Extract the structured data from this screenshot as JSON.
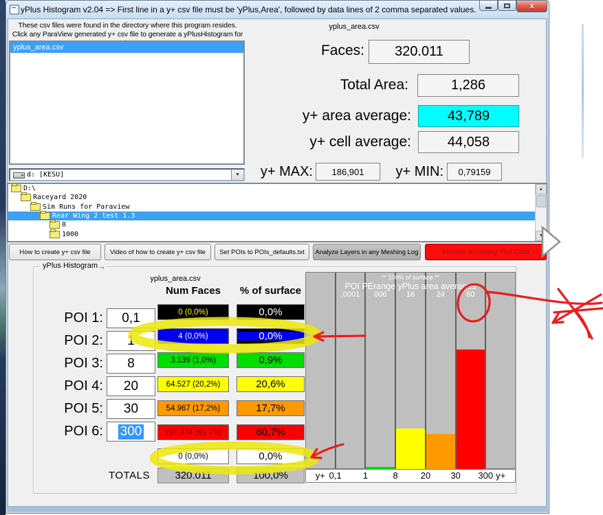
{
  "window": {
    "title": "yPlus Histogram v2.04 => First line in a y+ csv file must be 'yPlus,Area', followed by data lines of 2 comma separated values.",
    "controls": {
      "minimize": "minimize",
      "maximize": "maximize",
      "close": "close"
    }
  },
  "file_panel": {
    "instruction_line1": "These csv files were found in the directory where this program resides.",
    "instruction_line2": "Click any ParaView generated y+ csv file to generate a yPlusHistogram for it.",
    "files": [
      {
        "name": "yplus_area.csv",
        "selected": true
      }
    ]
  },
  "stats": {
    "csv_name": "yplus_area.csv",
    "faces_label": "Faces:",
    "faces_value": "320.011",
    "total_area_label": "Total Area:",
    "total_area_value": "1,286",
    "area_avg_label": "y+ area average:",
    "area_avg_value": "43,789",
    "area_avg_highlight": "#00ffff",
    "cell_avg_label": "y+ cell average:",
    "cell_avg_value": "44,058",
    "ymax_label": "y+ MAX:",
    "ymax_value": "186,901",
    "ymin_label": "y+ MIN:",
    "ymin_value": "0,79159"
  },
  "drive_combo": {
    "value": "d: [KESU]"
  },
  "dir_tree": {
    "items": [
      {
        "label": "D:\\",
        "indent": 0,
        "selected": false
      },
      {
        "label": "Raceyard 2020",
        "indent": 1,
        "selected": false
      },
      {
        "label": "Sim Runs for Paraview",
        "indent": 2,
        "selected": false
      },
      {
        "label": "Rear Wing 2 test 1.3",
        "indent": 3,
        "selected": true
      },
      {
        "label": "0",
        "indent": 4,
        "selected": false
      },
      {
        "label": "1000",
        "indent": 4,
        "selected": false
      }
    ]
  },
  "toolbar": {
    "buttons": [
      {
        "label": "How to create y+ csv file",
        "style": "normal"
      },
      {
        "label": "Video of how to create y+ csv file",
        "style": "normal"
      },
      {
        "label": "Set POIs to POIs_defaults.txt",
        "style": "normal"
      },
      {
        "label": "Analyze Layers in any Meshing Log",
        "style": "dark"
      },
      {
        "label": "Monitor Incoming Plot Data",
        "style": "red"
      }
    ]
  },
  "histogram": {
    "group_label": "yPlus Histogram .,",
    "csv_name": "yplus_area.csv",
    "col_header_faces": "Num Faces",
    "col_header_pct": "% of surface",
    "pois": [
      {
        "label": "POI 1:",
        "value": "0,1",
        "selected": false
      },
      {
        "label": "POI 2:",
        "value": "1",
        "selected": false
      },
      {
        "label": "POI 3:",
        "value": "8",
        "selected": false
      },
      {
        "label": "POI 4:",
        "value": "20",
        "selected": false
      },
      {
        "label": "POI 5:",
        "value": "30",
        "selected": false
      },
      {
        "label": "POI 6:",
        "value": "300",
        "selected": true
      }
    ],
    "rows": [
      {
        "num": "0 (0,0%)",
        "pct": "0,0%",
        "bg": "#000000",
        "num_color": "#ffff00",
        "pct_color": "#ffffff",
        "pct_variant": ""
      },
      {
        "num": "4 (0,0%)",
        "pct": "0,0%",
        "bg": "#0000f0",
        "num_color": "#ffffff",
        "pct_color": "#ffffff",
        "pct_variant": "black-edges"
      },
      {
        "num": "3.139 (1,0%)",
        "pct": "0,9%",
        "bg": "#00dd00",
        "num_color": "#000000",
        "pct_color": "#000000",
        "pct_variant": ""
      },
      {
        "num": "64.527 (20,2%)",
        "pct": "20,6%",
        "bg": "#ffff00",
        "num_color": "#000000",
        "pct_color": "#000000",
        "pct_variant": ""
      },
      {
        "num": "54.967 (17,2%)",
        "pct": "17,7%",
        "bg": "#ff9900",
        "num_color": "#000000",
        "pct_color": "#000000",
        "pct_variant": ""
      },
      {
        "num": "197.374 (61,7%)",
        "pct": "60,7%",
        "bg": "#ff0000",
        "num_color": "#7a0000",
        "pct_color": "#000000",
        "pct_variant": ""
      },
      {
        "num": "0 (0,0%)",
        "pct": "0,0%",
        "bg": "#ffffff",
        "num_color": "#000000",
        "pct_color": "#000000",
        "pct_variant": ""
      }
    ],
    "totals_label": "TOTALS",
    "totals": {
      "num": "320.011",
      "pct": "100,0%"
    }
  },
  "chart_data": {
    "type": "bar",
    "title": "** 100% of surface **",
    "subtitle": "POI PErange yPlus area averages",
    "categories": [
      "y+ < 0,1",
      "0,1 - 1",
      "1 - 8",
      "8 - 20",
      "20 - 30",
      "30 - 300",
      "300 < y+"
    ],
    "values": [
      0.0,
      0.0,
      0.9,
      20.6,
      17.7,
      60.7,
      0.0
    ],
    "bar_colors": [
      "#000000",
      "#0000f0",
      "#00dd00",
      "#ffff00",
      "#ff9900",
      "#ff0000",
      "#ffffff"
    ],
    "range_averages": [
      {
        "col": 1,
        "text": ",0001"
      },
      {
        "col": 2,
        "text": "006"
      },
      {
        "col": 3,
        "text": "16"
      },
      {
        "col": 4,
        "text": "24"
      },
      {
        "col": 5,
        "text": "60"
      }
    ],
    "x_axis_labels": [
      "y+",
      "0,1",
      "1",
      "8",
      "20",
      "30",
      "300",
      "y+"
    ],
    "xlabel": "y+",
    "ylabel": "",
    "ylim": [
      0,
      100
    ],
    "grid": "vertical-dividers",
    "plot_bg": "#bfbfbf",
    "legend": "none"
  },
  "annotations": {
    "highlight_row2": "yellow marker loop around the blue POI 2 result row",
    "highlight_row7": "yellow marker loop around the bottom zero result row",
    "arrow_row2": "red arrow pointing left at the blue POI 2 row",
    "arrow_row7": "red arrow pointing left at the bottom zero row",
    "circle_60": "red circle around range average value 60",
    "cross_out": "red crossed arrow strokes right of the window"
  }
}
